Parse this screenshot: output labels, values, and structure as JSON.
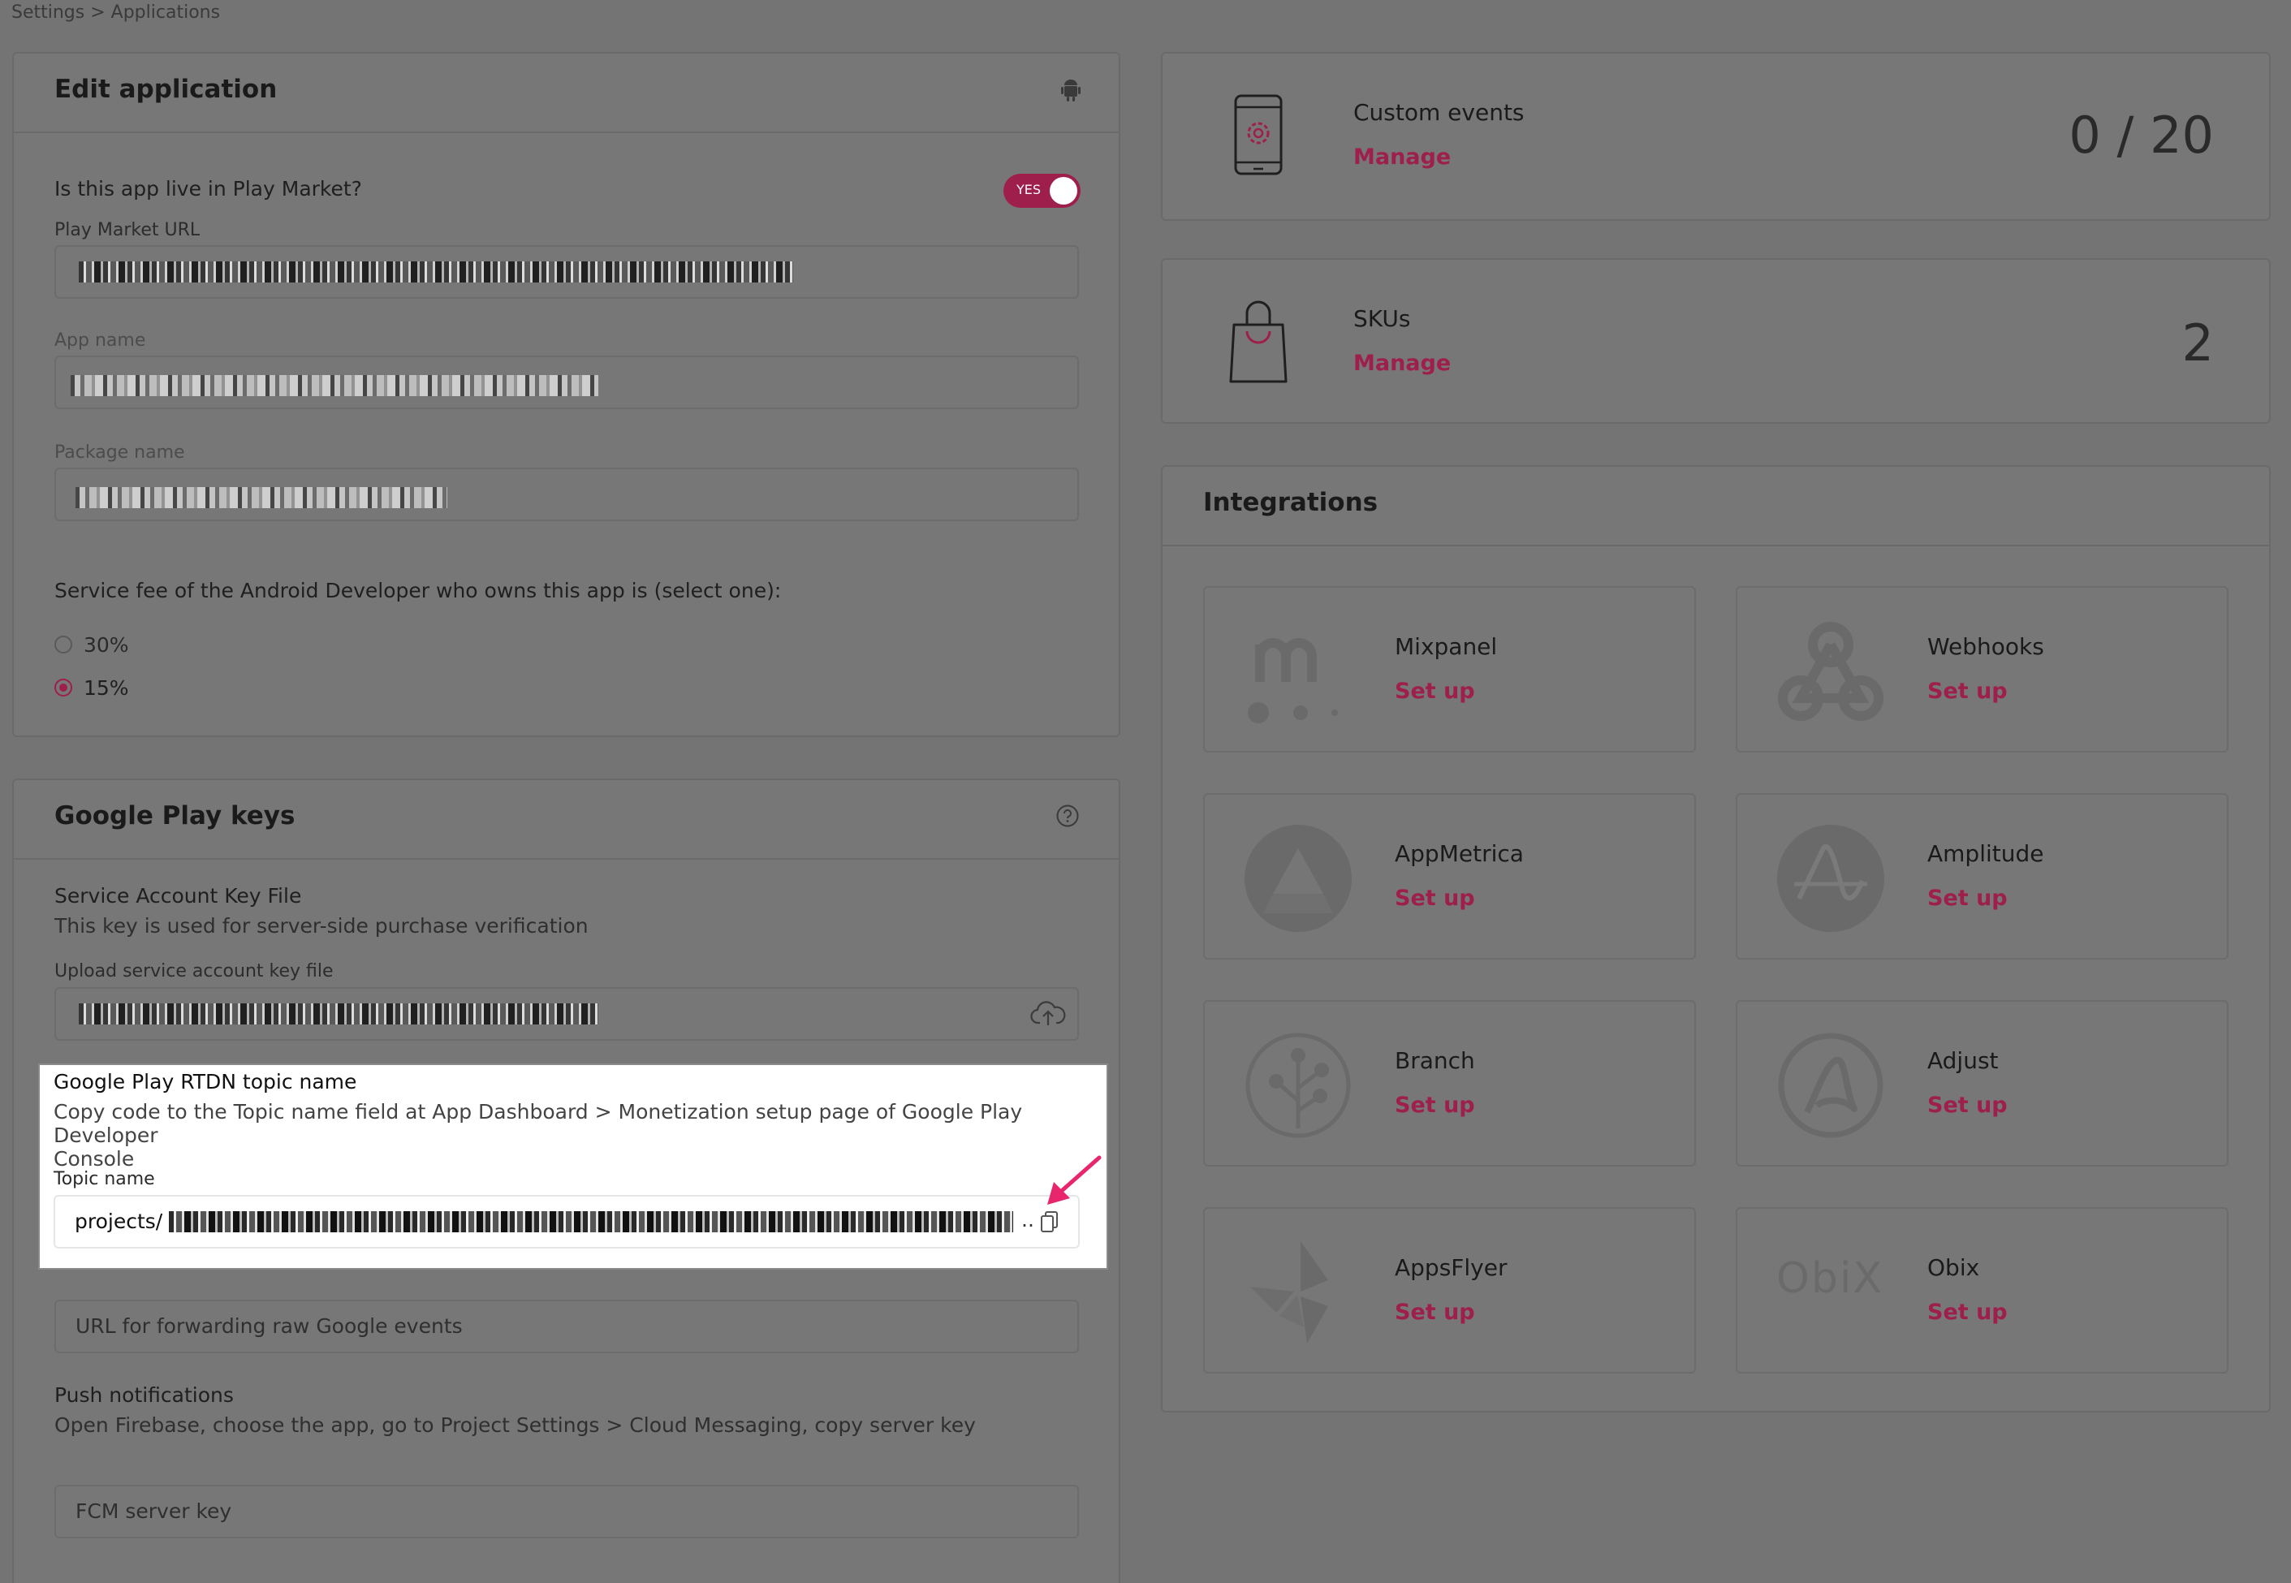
{
  "breadcrumb": {
    "root": "Settings",
    "sep": ">",
    "current": "Applications"
  },
  "edit_app": {
    "title": "Edit application",
    "live_question": "Is this app live in Play Market?",
    "live_toggle": "YES",
    "play_url_label": "Play Market URL",
    "app_name_label": "App name",
    "package_label": "Package name",
    "fee_question": "Service fee of the Android Developer who owns this app is (select one):",
    "fee_options": [
      "30%",
      "15%"
    ],
    "fee_selected": "15%"
  },
  "keys": {
    "title": "Google Play keys",
    "sa_title": "Service Account Key File",
    "sa_desc": "This key is used for server-side purchase verification",
    "upload_label": "Upload service account key file",
    "rtdn_title": "Google Play RTDN topic name",
    "rtdn_desc_1": "Copy code to the Topic name field at App Dashboard > Monetization setup page of Google Play Developer",
    "rtdn_desc_2": "Console",
    "topic_label": "Topic name",
    "topic_value": "projects/",
    "forward_placeholder": "URL for forwarding raw Google events",
    "push_title": "Push notifications",
    "push_desc": "Open Firebase, choose the app, go to Project Settings > Cloud Messaging, copy server key",
    "fcm_placeholder": "FCM server key"
  },
  "custom_events": {
    "name": "Custom events",
    "link": "Manage",
    "count": "0 / 20"
  },
  "skus": {
    "name": "SKUs",
    "link": "Manage",
    "count": "2"
  },
  "integrations": {
    "title": "Integrations",
    "items": [
      {
        "name": "Mixpanel",
        "action": "Set up",
        "icon": "mixpanel-logo"
      },
      {
        "name": "Webhooks",
        "action": "Set up",
        "icon": "webhooks-logo"
      },
      {
        "name": "AppMetrica",
        "action": "Set up",
        "icon": "appmetrica-logo"
      },
      {
        "name": "Amplitude",
        "action": "Set up",
        "icon": "amplitude-logo"
      },
      {
        "name": "Branch",
        "action": "Set up",
        "icon": "branch-logo"
      },
      {
        "name": "Adjust",
        "action": "Set up",
        "icon": "adjust-logo"
      },
      {
        "name": "AppsFlyer",
        "action": "Set up",
        "icon": "appsflyer-logo"
      },
      {
        "name": "Obix",
        "action": "Set up",
        "icon": "obix-logo",
        "logo_text": "ObiX"
      }
    ]
  },
  "colors": {
    "accent": "#9e1e4c",
    "annotation_arrow": "#e8266e",
    "overlay": "#747474"
  }
}
